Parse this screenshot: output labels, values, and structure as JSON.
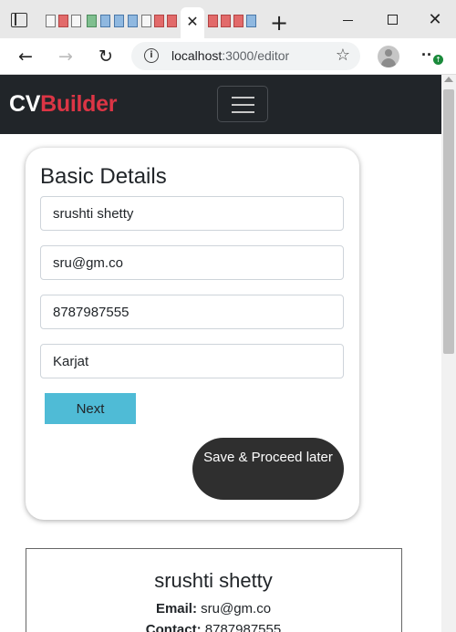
{
  "browser": {
    "active_tab_close": "✕",
    "new_tab": "+",
    "window_minimize": "",
    "window_maximize": "",
    "window_close": "✕",
    "back": "←",
    "forward": "→",
    "reload": "↻",
    "url_host": "localhost",
    "url_path": ":3000/editor",
    "favorites_icon": "☆",
    "more": "··",
    "update_badge": "↑"
  },
  "navbar": {
    "brand_cv": "CV",
    "brand_builder": "Builder",
    "brand_color_accent": "#dc3545",
    "background": "#212529"
  },
  "form": {
    "title": "Basic Details",
    "name": "srushti shetty",
    "email": "sru@gm.co",
    "contact": "8787987555",
    "address": "Karjat",
    "next_label": "Next",
    "next_color": "#4fbbd6",
    "save_label": "Save & Proceed later"
  },
  "preview": {
    "name": "srushti shetty",
    "email_label": "Email:",
    "email": "sru@gm.co",
    "contact_label": "Contact:",
    "contact": "8787987555"
  },
  "icons": [
    "tab-actions-icon",
    "close-icon",
    "plus-icon",
    "minimize-icon",
    "maximize-icon",
    "back-icon",
    "forward-icon",
    "reload-icon",
    "info-icon",
    "favorites-icon",
    "profile-icon",
    "more-icon",
    "hamburger-icon"
  ]
}
